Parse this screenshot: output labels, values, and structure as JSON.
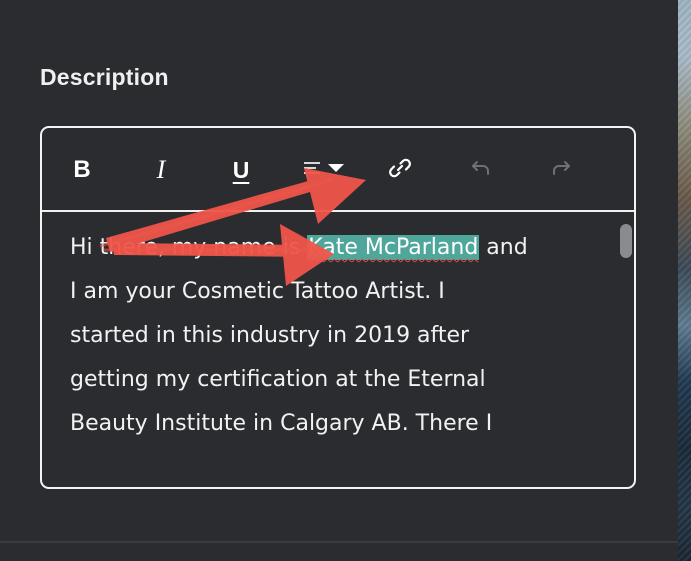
{
  "section": {
    "title": "Description"
  },
  "toolbar": {
    "bold_label": "B",
    "italic_label": "I",
    "underline_label": "U",
    "list_icon": "list-dropdown-icon",
    "link_icon": "link-icon",
    "undo_icon": "undo-icon",
    "redo_icon": "redo-icon"
  },
  "editor": {
    "line1_before": "Hi there, my name is ",
    "highlighted_name": "Kate McParland",
    "line1_after": " and",
    "line2": "I am your Cosmetic Tattoo Artist. I",
    "line3": "started in this industry in 2019 after",
    "line4": "getting my certification at the  Eternal",
    "line5": "Beauty Institute in Calgary AB. There I"
  },
  "colors": {
    "background": "#2b2c30",
    "border": "#f4f4f4",
    "highlight": "#4ea79a",
    "annotation_arrow": "#f0564a"
  }
}
